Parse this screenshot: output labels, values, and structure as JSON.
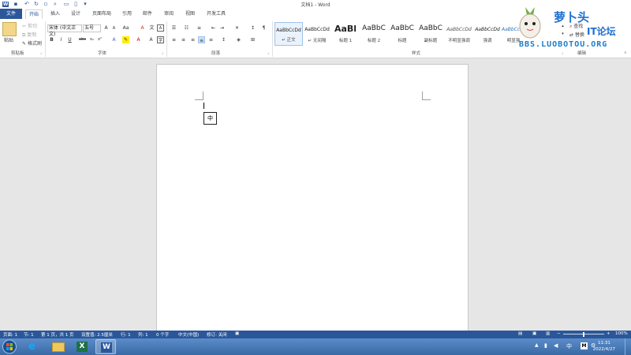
{
  "window": {
    "title": "文档1 - Word",
    "login": "登录"
  },
  "tabs": [
    {
      "label": "文件"
    },
    {
      "label": "开始"
    },
    {
      "label": "插入"
    },
    {
      "label": "设计"
    },
    {
      "label": "页面布局"
    },
    {
      "label": "引用"
    },
    {
      "label": "邮件"
    },
    {
      "label": "审阅"
    },
    {
      "label": "视图"
    },
    {
      "label": "开发工具"
    }
  ],
  "clipboard": {
    "paste": "粘贴",
    "cut": "剪切",
    "copy": "复制",
    "format_painter": "格式刷",
    "label": "剪贴板"
  },
  "font": {
    "name": "宋体 (中文正文)",
    "size": "五号",
    "label": "字体"
  },
  "paragraph": {
    "label": "段落"
  },
  "styles": {
    "label": "样式",
    "items": [
      {
        "sample": "AaBbCcDd",
        "name": "↵ 正文"
      },
      {
        "sample": "AaBbCcDd",
        "name": "↵ 无间隔"
      },
      {
        "sample": "AaBl",
        "name": "标题 1"
      },
      {
        "sample": "AaBbC",
        "name": "标题 2"
      },
      {
        "sample": "AaBbC",
        "name": "标题"
      },
      {
        "sample": "AaBbC",
        "name": "副标题"
      },
      {
        "sample": "AaBbCcDd",
        "name": "不明显强调"
      },
      {
        "sample": "AaBbCcDd",
        "name": "强调"
      },
      {
        "sample": "AaBbCcDd",
        "name": "明显强"
      }
    ]
  },
  "editing": {
    "find": "查找",
    "replace": "替换",
    "label": "编辑"
  },
  "document": {
    "ime_char": "中"
  },
  "statusbar": {
    "page": "页面: 1",
    "section": "节: 1",
    "pages": "第 1 页，共 1 页",
    "position": "设置值: 2.5厘米",
    "row": "行: 1",
    "col": "列: 1",
    "words": "0 个字",
    "language": "中文(中国)",
    "revisions": "修订: 关闭",
    "zoom": "100%"
  },
  "taskbar": {
    "time": "11:31",
    "date": "2022/4/27",
    "ime": "中"
  },
  "watermark": {
    "line1": "萝卜头",
    "line2": "IT论坛",
    "line3": "BBS.LUOBOTOU.ORG"
  },
  "colors": {
    "accent": "#2b579a",
    "watermark": "#1e6fd0"
  }
}
